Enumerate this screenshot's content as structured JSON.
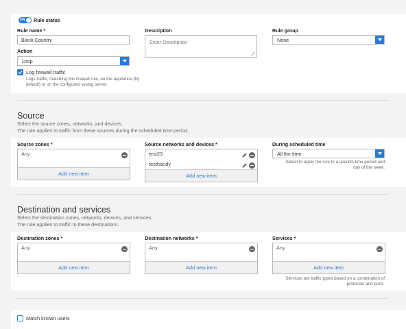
{
  "rule_status": {
    "toggle_text": "ON",
    "label": "Rule status"
  },
  "general": {
    "rule_name_label": "Rule name *",
    "rule_name_value": "Block Country",
    "description_label": "Description",
    "description_placeholder": "Enter Description",
    "rule_group_label": "Rule group",
    "rule_group_value": "None",
    "action_label": "Action",
    "action_value": "Drop",
    "log_label": "Log firewall traffic",
    "log_checked": true,
    "log_help_1": "Logs traffic, matching this firewall rule, on the appliance (by",
    "log_help_2": "default) or on the configured syslog server."
  },
  "source": {
    "title": "Source",
    "subtitle_1": "Select the source zones, networks, and devices.",
    "subtitle_2": "The rule applies to traffic from these sources during the scheduled time period.",
    "zones_label": "Source zones *",
    "zones_items": [
      "Any"
    ],
    "zones_add": "Add new item",
    "networks_label": "Source networks and devices *",
    "networks_items": [
      "test23",
      "testhandy"
    ],
    "networks_add": "Add new item",
    "schedule_label": "During scheduled time",
    "schedule_value": "All the time",
    "schedule_help_1": "Select to apply the rule to a specific time period and",
    "schedule_help_2": "day of the week."
  },
  "destination": {
    "title": "Destination and services",
    "subtitle_1": "Select the destination zones, networks, devices, and services.",
    "subtitle_2": "The rule applies to traffic to these destinations.",
    "zones_label": "Destination zones *",
    "zones_items": [
      "Any"
    ],
    "zones_add": "Add new item",
    "networks_label": "Destination networks *",
    "networks_items": [
      "Any"
    ],
    "networks_add": "Add new item",
    "services_label": "Services *",
    "services_items": [
      "Any"
    ],
    "services_add": "Add new item",
    "services_help_1": "Services are traffic types based on a combination of",
    "services_help_2": "protocols and ports."
  },
  "identity": {
    "match_users_label": "Match known users",
    "match_users_checked": false
  },
  "colors": {
    "accent": "#2a7bd6",
    "background": "#f3f3f3",
    "panel": "#ffffff"
  },
  "icons": [
    "minus-circle-icon",
    "pencil-icon",
    "chevron-down-icon",
    "check-icon",
    "resize-grip-icon"
  ]
}
